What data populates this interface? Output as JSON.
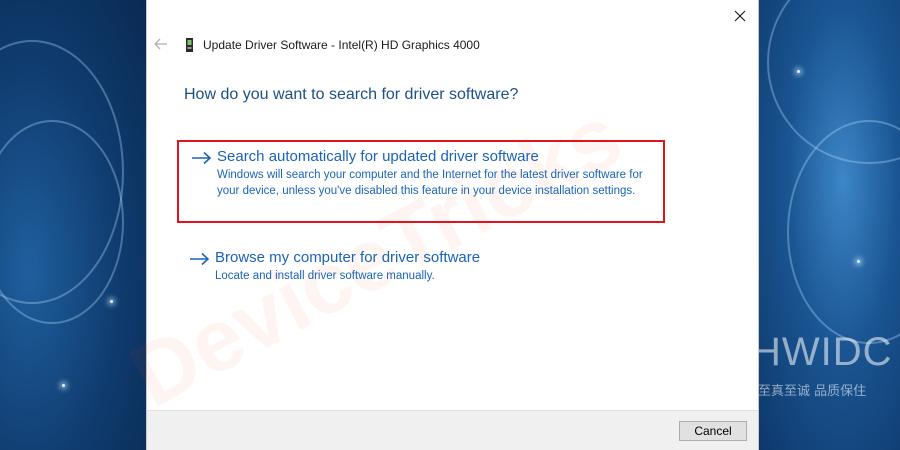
{
  "window": {
    "title": "Update Driver Software - Intel(R) HD Graphics 4000"
  },
  "question": "How do you want to search for driver software?",
  "options": [
    {
      "title": "Search automatically for updated driver software",
      "description": "Windows will search your computer and the Internet for the latest driver software for your device, unless you've disabled this feature in your device installation settings.",
      "highlighted": true
    },
    {
      "title": "Browse my computer for driver software",
      "description": "Locate and install driver software manually.",
      "highlighted": false
    }
  ],
  "footer": {
    "cancel_label": "Cancel"
  },
  "watermarks": {
    "dialog": "DeviceTricks",
    "desktop_big": "HWIDC",
    "desktop_small": "至真至诚 品质保住"
  },
  "icons": {
    "close": "close-icon",
    "back": "back-arrow-icon",
    "device": "device-icon",
    "option_arrow": "arrow-right-icon"
  },
  "colors": {
    "link_blue": "#1a63b8",
    "heading_blue": "#1b4f8a",
    "highlight_red": "#e0141c"
  }
}
